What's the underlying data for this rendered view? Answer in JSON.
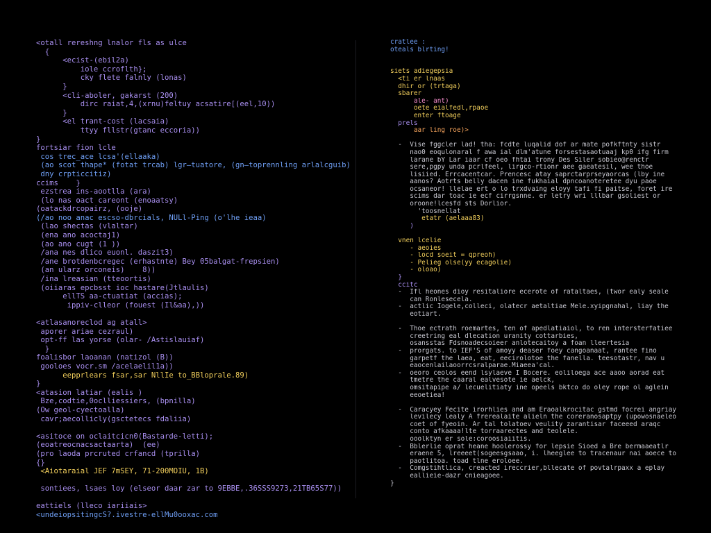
{
  "colors": {
    "background": "#000000",
    "purple": "#a98ff0",
    "blue": "#6f9ff5",
    "yellow": "#f2cf5c",
    "gray": "#c9c9d2"
  },
  "left_code": [
    "<otall rereshng lnalor fls as ulce",
    "  {",
    "      <ecist-(ebil2a)",
    "          iole ccroflth};",
    "          cky flete falnly (lonas)",
    "      }",
    "      <cli-aboler, gakarst (200)",
    "          dirc raiat,4,(xrnu)feltuy acsatire[(eel,10))",
    "      }",
    "      <el trant-cost (lacsaia)",
    "          ttyy fllstr(gtanc eccoria))",
    "}",
    "fortsiar fion lcle",
    " cos trec_ace lcsa'(ellaaka)",
    " (ao scot thape* (fotat trcab) lgr—tuatore, (gn—toprennling arlalcguib)",
    " dny crpticcitiz)",
    "ccims    }",
    " ezstrea ins-aootlla (ara)",
    " (lo nas oact careont (enoaatsy)",
    "(oatackdrcopairz, (ooje)",
    "(/ao noo anac escso-dbrcials, NULl-Ping (o'lhe ieaa)",
    " (lao shectas (vlaltar)",
    " (ena ano acoctaj1)",
    " (ao ano cugt (1 ))",
    " /ana nes dlico euonl. daszit3)",
    " /ane brotdenbcregec (erhastnte) Bey 05balgat-frepsien)",
    " (an ularz orconeis)    8))",
    " /ina lreasian (tteoortis)",
    " (oiiaras epcbsst ioc hastare(Jtlaulis)",
    "      ellTS aa-ctuatiat (accias);",
    "       ippiv-clleor (fouest (Il&aa),))",
    "",
    "<atlasanoreclod ag atall>",
    " aporer ariae cezraul)",
    " opt-ff las yorse (olar- /Astislauiaf)",
    "  }",
    "foalisbor laoanan (natizol (B))",
    " gooloes vocr.sm /acelaelil1a))",
    "      eepprlears fsar,sar NllIe to_BBloprale.89)",
    "}",
    "<atasion latiar (ealis )",
    " Bze,codtie,0oclliessiers, (bpnilla)",
    "(Ow geol-cyectoalla)",
    " cavr;aecollicly(gsctetecs fdaliia)",
    "",
    "<asitoce on oclaitcicn0(Bastarde-letti);",
    "(eoatreocnacsactaarta)  (ee)",
    "(pro laoda prcruted crfancd (tprilla)",
    "{}",
    " <Aiotaraial JEF 7mSEY, 71-200MOIU, 1B)",
    "",
    " sontiees, lsaes loy (elseor daar zar to 9EBBE,.36SSS9273,21TB65S77))",
    "",
    "eattiels (lleco iariiais>",
    "<undeiopsitingcS?.ivestre-ellMu0ooxac.com"
  ],
  "right_code": [
    "cratlee :",
    "oteals blrting!",
    "",
    "",
    "siets adiegepsia",
    "  <ti er lnaas",
    "  dhir or (trtaga)",
    "  sbarer",
    "      ale- ant)",
    "      oete eialfedl,rpaoe",
    "      enter ftoage",
    "  prels",
    "      aar ling roe)>",
    "",
    "  -  Vise fggcler lad! tha: fcdte luqalid dof ar mate pofkftnty sistr",
    "     nao0 eoqulonaral f awa ial dlm'atune forsestasaotuaaj kp0 ifg firm",
    "     larane bY Lar iaar cf oeo fhtai trony Des Siler sobieo@renctr",
    "     sere,pgpy unda pcrlfeel, lirgco-rtionr aee gaeatesil, wee thoe",
    "     lisiied. Errcacentcar. Prencesc atay saprctarprseyaorcas (lby ine",
    "     aanos? Aotrts belly dacen ine fukhaial dpncoanoteretee dyu paoe",
    "     ocsaneor! llelae ert o lo trxdvaing eloyy tafi fi paitse, foret ire",
    "     scims dar toac ie ecf cirrgsnne. er letry wri lllbar gsoliest or",
    "     oroone!lcesfd sts Dorlior.",
    "       'toosnellat",
    "        etatr (aelaaa83)",
    "     )",
    "",
    "  vnen lcelie",
    "     - aeoies",
    "     - locd soeit = qpreoh)",
    "     - Pelieg olse(yy ecagolie)",
    "     - oloao)",
    "  }",
    "  ccitc",
    "  -  Ifl heones dioy resitaliore ecerote of rataltaes, (twor ealy seale",
    "     can Ronlesecela.",
    "  -  actlic Iogele,colleci, olatecr aetaltiae Mele.xyipgnahal, liay the",
    "     eotiart.",
    "",
    "  -  Thoe ectrath roemartes, ten of apedlatiaiol, to ren intersterfatiee",
    "     creetring eal dlecation uranity cottarbies,",
    "     osansstas Fdsnoadecsoieer anlotecaitoy a foan lleertesia",
    "  -  prorgats. to IEF'S of amoyy deaser foey cangoanaat, rantee fino",
    "     garpetf the laea, eat, eecirolotoe the fanella. teesotastr, nav u",
    "     eaocenlailaoorrcsralparae.Miaeea'cal.",
    "  -  oeoro ceolos eend lsylaeve I Bocere. eoliloega ace aaoo aorad eat",
    "     tmetre the caaral ealvesote ie aelck,",
    "     omsitapipe a/ lecuelitiaty ine opeels bktco do oley rope ol aglein",
    "     eeoetiea!",
    "",
    "  -  Caracyey Fecite irorhlies and am Eraoalkrocitac gstmd focrei angriay",
    "     levilecy lealy A frerealaite alieln the coreranosaptpy (upowosnaeleo",
    "     coet of fyeoin. Ar tal tolatoev veulity zarantisar faceeed araqc",
    "     conto afkaaaa!lte torraarectes and teolele.",
    "     ooolktyn er sole:coroosiaiitis.",
    "  -  Bblerlie oprat heane hoolerossy for lepsie Sioed a Bre bermaaeatlr",
    "     eraene 5, lreeeet(sogeesgsaao, i. lheeglee to tracenaur nai aoece to",
    "     paotlitoa. toad tlne eroloee.",
    "  -  Comgstihtlica, creacted ireccrier,bllecate of povtalrpaxx a eplay",
    "     eallieie-dazr cnieagoee.",
    "}"
  ]
}
